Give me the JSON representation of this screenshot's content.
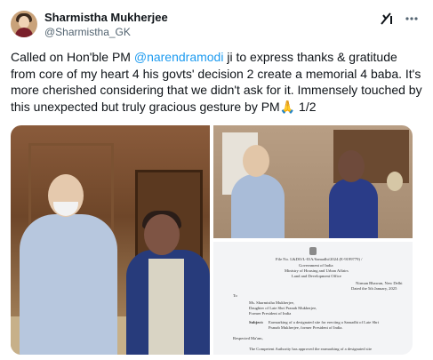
{
  "author": {
    "name": "Sharmistha Mukherjee",
    "handle": "@Sharmistha_GK"
  },
  "icons": {
    "grok": "grok-icon",
    "more": "more-icon"
  },
  "tweet": {
    "text_before": "Called on Hon'ble PM ",
    "mention": "@narendramodi",
    "text_after": " ji to express thanks & gratitude from core of my heart 4 his govts' decision 2 create a memorial 4 baba. It's more cherished considering that we didn't ask for it. Immensely touched by this unexpected but truly gracious gesture by PM🙏 1/2"
  },
  "document": {
    "fileno": "File No. L&DO/L-II/A/Samadhi/2024 (E-9199779) /",
    "gov1": "Government of India",
    "gov2": "Ministry of Housing and Urban Affairs",
    "gov3": "Land and Development Office",
    "place": "Nirman Bhawan, New Delhi",
    "dated": "Dated the 5th January, 2025",
    "to": "To",
    "addr1": "Ms. Sharmistha Mukherjee,",
    "addr2": "Daughter of Late Shri Pranab Mukherjee,",
    "addr3": "Former President of India",
    "subject_label": "Subject:",
    "subject1": "Earmarking of a designated site for erecting a Samadhi of Late Shri",
    "subject2": "Pranab Mukherjee, former President of India.",
    "salutation": "Respected Ma'am,",
    "body": "The Competent Authority has approved the earmarking of a designated site"
  }
}
